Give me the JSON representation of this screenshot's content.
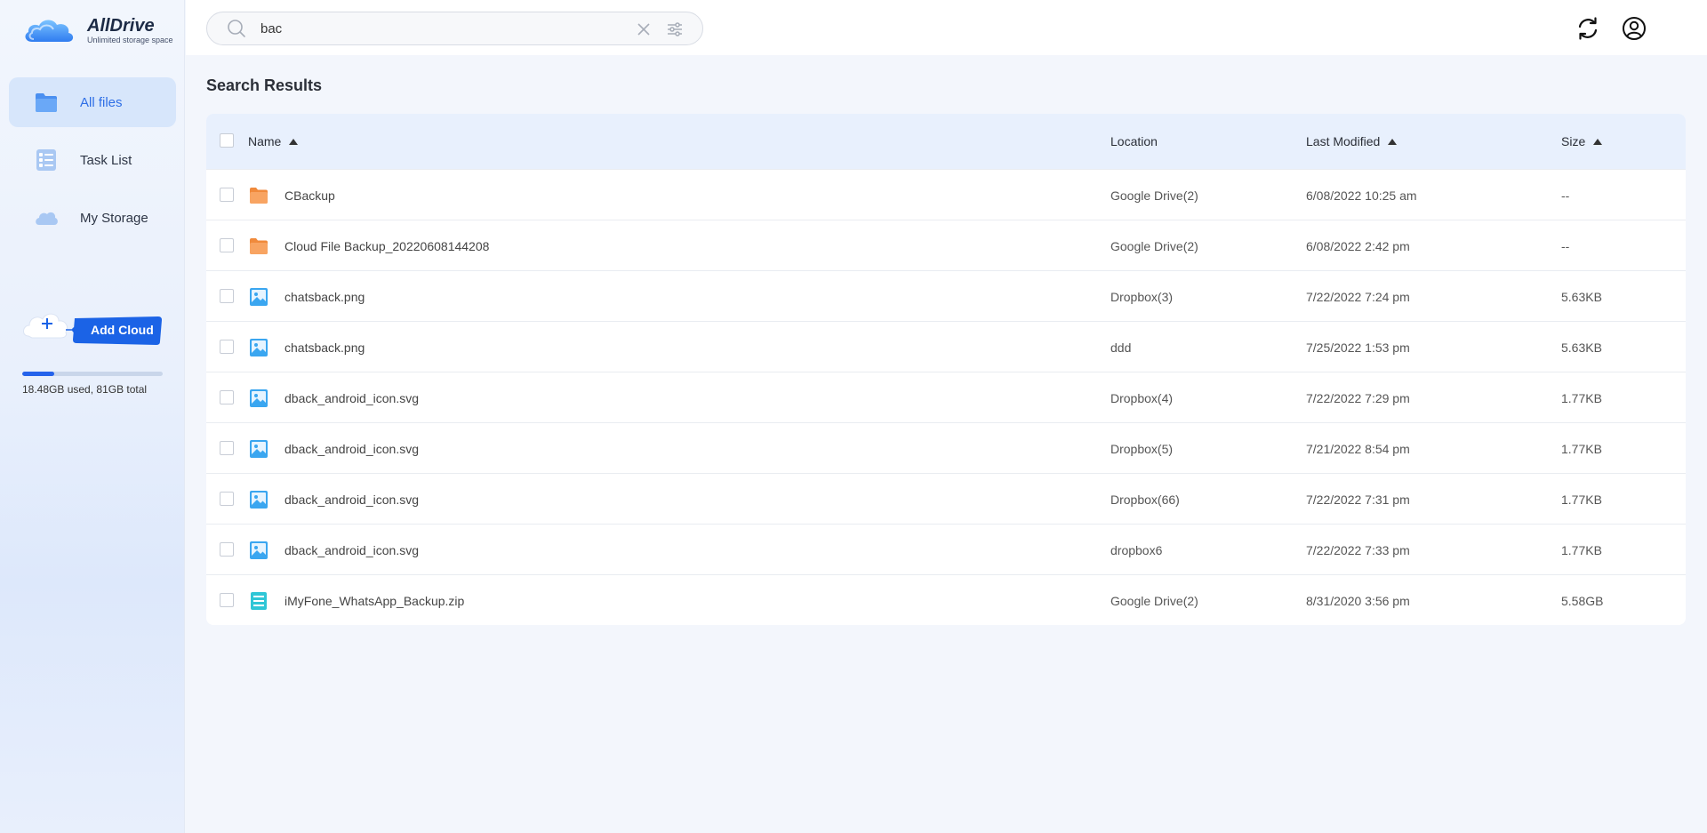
{
  "app": {
    "name": "AllDrive",
    "tagline": "Unlimited storage space"
  },
  "sidebar": {
    "items": [
      {
        "label": "All files",
        "icon": "folder-icon",
        "active": true
      },
      {
        "label": "Task List",
        "icon": "task-list-icon",
        "active": false
      },
      {
        "label": "My Storage",
        "icon": "cloud-icon",
        "active": false
      }
    ],
    "add_cloud_label": "Add Cloud",
    "storage": {
      "text": "18.48GB used, 81GB total",
      "used_fraction": 0.228
    }
  },
  "search": {
    "value": "bac",
    "placeholder": "Search"
  },
  "main": {
    "title": "Search Results",
    "columns": {
      "name": "Name",
      "location": "Location",
      "modified": "Last Modified",
      "size": "Size"
    },
    "rows": [
      {
        "name": "CBackup",
        "type": "folder",
        "location": "Google Drive(2)",
        "modified": "6/08/2022 10:25 am",
        "size": "--"
      },
      {
        "name": "Cloud File Backup_20220608144208",
        "type": "folder",
        "location": "Google Drive(2)",
        "modified": "6/08/2022 2:42 pm",
        "size": "--"
      },
      {
        "name": "chatsback.png",
        "type": "image",
        "location": "Dropbox(3)",
        "modified": "7/22/2022 7:24 pm",
        "size": "5.63KB"
      },
      {
        "name": "chatsback.png",
        "type": "image",
        "location": "ddd",
        "modified": "7/25/2022 1:53 pm",
        "size": "5.63KB"
      },
      {
        "name": "dback_android_icon.svg",
        "type": "image",
        "location": "Dropbox(4)",
        "modified": "7/22/2022 7:29 pm",
        "size": "1.77KB"
      },
      {
        "name": "dback_android_icon.svg",
        "type": "image",
        "location": "Dropbox(5)",
        "modified": "7/21/2022 8:54 pm",
        "size": "1.77KB"
      },
      {
        "name": "dback_android_icon.svg",
        "type": "image",
        "location": "Dropbox(66)",
        "modified": "7/22/2022 7:31 pm",
        "size": "1.77KB"
      },
      {
        "name": "dback_android_icon.svg",
        "type": "image",
        "location": "dropbox6",
        "modified": "7/22/2022 7:33 pm",
        "size": "1.77KB"
      },
      {
        "name": "iMyFone_WhatsApp_Backup.zip",
        "type": "archive",
        "location": "Google Drive(2)",
        "modified": "8/31/2020 3:56 pm",
        "size": "5.58GB"
      }
    ]
  },
  "colors": {
    "accent": "#2f6fe6",
    "active_nav_bg": "#d7e6fb",
    "header_bg": "#e8f0fd",
    "folder": "#f5924a",
    "image": "#3aa6f0",
    "archive": "#2fc6d6"
  }
}
